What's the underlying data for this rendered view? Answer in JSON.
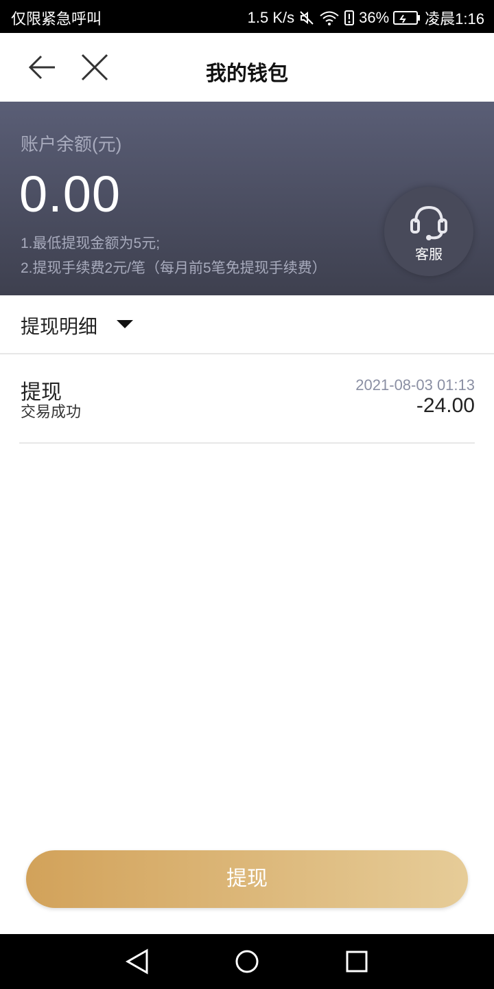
{
  "status_bar": {
    "carrier": "仅限紧急呼叫",
    "speed": "1.5 K/s",
    "battery": "36%",
    "time": "凌晨1:16"
  },
  "nav": {
    "title": "我的钱包"
  },
  "wallet": {
    "balance_label": "账户余额(元)",
    "balance": "0.00",
    "rules": [
      "1.最低提现金额为5元;",
      "2.提现手续费2元/笔（每月前5笔免提现手续费）"
    ],
    "customer_service": "客服"
  },
  "details": {
    "header": "提现明细",
    "transactions": [
      {
        "title": "提现",
        "status": "交易成功",
        "time": "2021-08-03 01:13",
        "amount": "-24.00"
      }
    ]
  },
  "actions": {
    "withdraw": "提现"
  },
  "colors": {
    "gold_start": "#d2a25a",
    "gold_end": "#e6cc98",
    "card_top": "#5a5e76",
    "card_bottom": "#3e404f"
  }
}
